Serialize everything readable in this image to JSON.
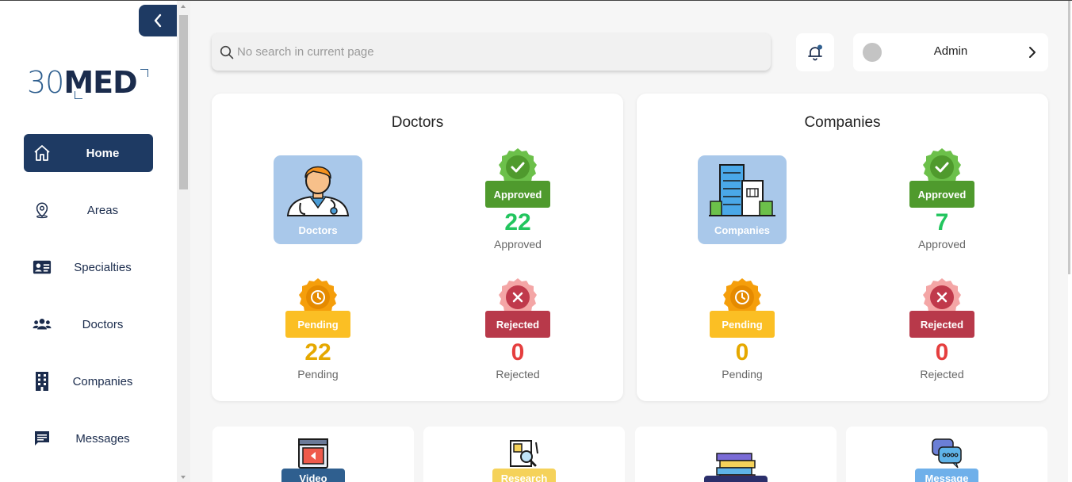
{
  "sidebar": {
    "logo": {
      "part1": "30",
      "part2": "MED"
    },
    "items": [
      {
        "label": "Home",
        "icon": "home-icon",
        "active": true
      },
      {
        "label": "Areas",
        "icon": "map-pin-icon"
      },
      {
        "label": "Specialties",
        "icon": "id-card-icon"
      },
      {
        "label": "Doctors",
        "icon": "users-icon"
      },
      {
        "label": "Companies",
        "icon": "building-icon"
      },
      {
        "label": "Messages",
        "icon": "message-icon"
      }
    ]
  },
  "header": {
    "search_placeholder": "No search in current page",
    "user_name": "Admin"
  },
  "cards": {
    "doctors": {
      "title": "Doctors",
      "hero_label": "Doctors",
      "approved": {
        "badge": "Approved",
        "value": "22",
        "caption": "Approved"
      },
      "pending": {
        "badge": "Pending",
        "value": "22",
        "caption": "Pending"
      },
      "rejected": {
        "badge": "Rejected",
        "value": "0",
        "caption": "Rejected"
      }
    },
    "companies": {
      "title": "Companies",
      "hero_label": "Companies",
      "approved": {
        "badge": "Approved",
        "value": "7",
        "caption": "Approved"
      },
      "pending": {
        "badge": "Pending",
        "value": "0",
        "caption": "Pending"
      },
      "rejected": {
        "badge": "Rejected",
        "value": "0",
        "caption": "Rejected"
      }
    }
  },
  "tiles": [
    {
      "label": "Video",
      "color": "#2f5f8f"
    },
    {
      "label": "Research",
      "color": "#f5d25a"
    },
    {
      "label": "",
      "color": "#2b2f6b"
    },
    {
      "label": "Message",
      "color": "#6fb0ea"
    }
  ],
  "colors": {
    "primary": "#1e3a63",
    "approved": "#22c55e",
    "approved_badge": "#4f9a2d",
    "pending": "#e5a800",
    "pending_badge": "#fbbf24",
    "rejected": "#e53e3e",
    "rejected_badge": "#b8394a"
  }
}
